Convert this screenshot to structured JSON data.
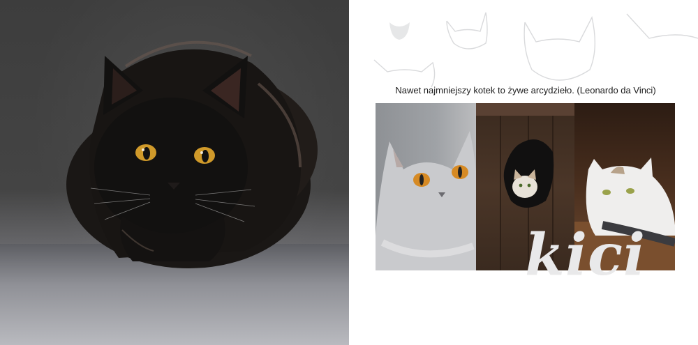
{
  "quote": {
    "text": "Nawet najmniejszy kotek to żywe arcydzieło. (Leonardo da Vinci)"
  },
  "script_word": "kici",
  "colors": {
    "page_background": "#ffffff",
    "doodle_gray": "#d9dadc",
    "script_gray": "#e9e9ea",
    "cat_black": "#121110",
    "eye_amber": "#d09a2a"
  },
  "icons": [
    "black-cat-illustration",
    "gray-cat-illustration",
    "wooden-door-illustration",
    "tabby-cat-illustration",
    "cat-head-doodle"
  ]
}
